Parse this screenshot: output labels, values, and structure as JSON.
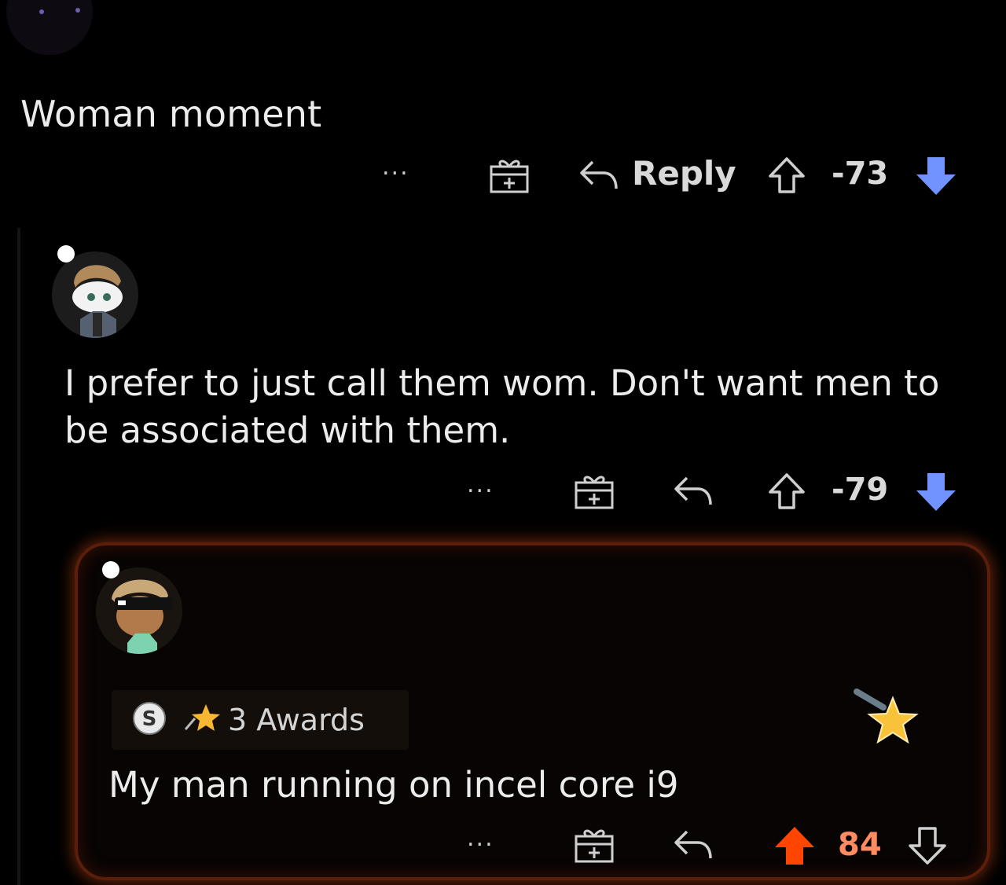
{
  "parent_comment": {
    "body": "Woman moment",
    "actions": {
      "more_label": "...",
      "reply_label": "Reply",
      "score": "-73"
    }
  },
  "reply_comment": {
    "body": "I prefer to just call them wom. Don't want men to be associated with them.",
    "actions": {
      "more_label": "...",
      "score": "-79"
    }
  },
  "nested_reply": {
    "awards_label": "3 Awards",
    "body": "My man running on incel core i9",
    "actions": {
      "more_label": "...",
      "score": "84"
    }
  },
  "colors": {
    "background": "#000000",
    "downvote_active": "#7193ff",
    "upvote_active": "#ff4500",
    "highlight_glow": "#aa3c14"
  },
  "icons": [
    "gift-icon",
    "reply-icon",
    "upvote-icon",
    "downvote-icon",
    "silver-award-icon",
    "star-award-icon"
  ]
}
